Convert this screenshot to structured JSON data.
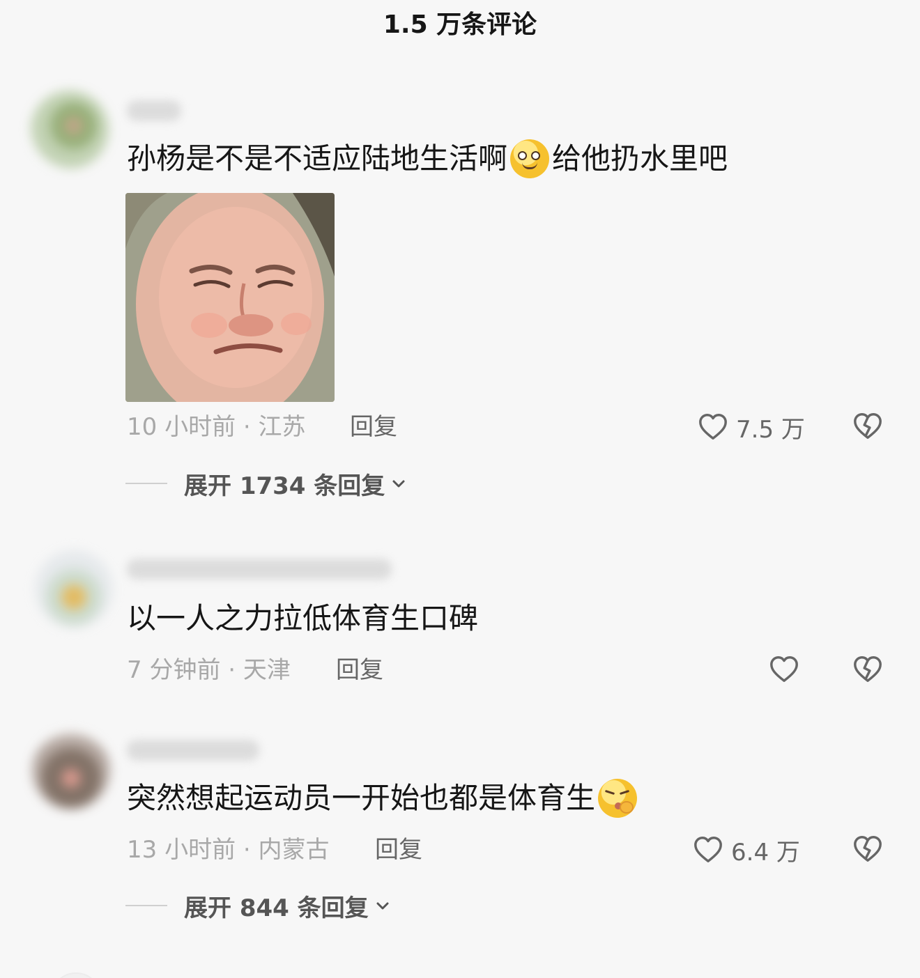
{
  "header": {
    "title": "1.5 万条评论"
  },
  "comments": [
    {
      "text_before": "孙杨是不是不适应陆地生活啊",
      "text_after": "给他扔水里吧",
      "emoji": "dizzy-eyes-emoji",
      "image": "grimacing-face-photo",
      "time_location": "10 小时前 · 江苏",
      "reply_label": "回复",
      "likes": "7.5 万",
      "expand_label": "展开 1734 条回复"
    },
    {
      "text_before": "以一人之力拉低体育生口碑",
      "time_location": "7 分钟前 · 天津",
      "reply_label": "回复",
      "likes": ""
    },
    {
      "text_before": "突然想起运动员一开始也都是体育生",
      "emoji": "shushing-pout-emoji",
      "time_location": "13 小时前 · 内蒙古",
      "reply_label": "回复",
      "likes": "6.4 万",
      "expand_label": "展开 844 条回复"
    }
  ],
  "colors": {
    "background": "#f7f7f7",
    "text_primary": "#161616",
    "text_meta": "#a8a8a8",
    "text_action": "#666666"
  },
  "icons": [
    "heart-outline-icon",
    "broken-heart-outline-icon",
    "chevron-down-icon"
  ]
}
